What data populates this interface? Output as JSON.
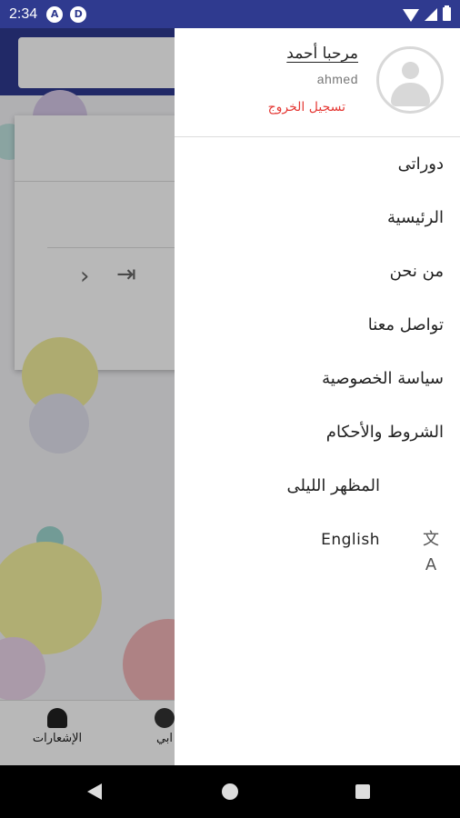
{
  "status_bar": {
    "time": "2:34",
    "icons": [
      "notification-a-icon",
      "notification-d-icon",
      "wifi-icon",
      "signal-icon",
      "battery-icon"
    ]
  },
  "background_app": {
    "bottom_nav": {
      "notifications_label": "الإشعارات",
      "account_label_partial": "ابي"
    }
  },
  "drawer": {
    "header": {
      "welcome": "مرحبا أحمد",
      "username": "ahmed",
      "logout": "تسجيل الخروج",
      "logout_color": "#e53935"
    },
    "items": [
      {
        "label": "دوراتى"
      },
      {
        "label": "الرئيسية"
      },
      {
        "label": "من نحن"
      },
      {
        "label": "تواصل معنا"
      },
      {
        "label": "سياسة الخصوصية"
      },
      {
        "label": "الشروط والأحكام"
      },
      {
        "label": "المظهر الليلى",
        "icon": "moon-icon"
      },
      {
        "label": "English",
        "icon": "translate-icon"
      }
    ]
  },
  "colors": {
    "primary": "#2f3a8f"
  }
}
